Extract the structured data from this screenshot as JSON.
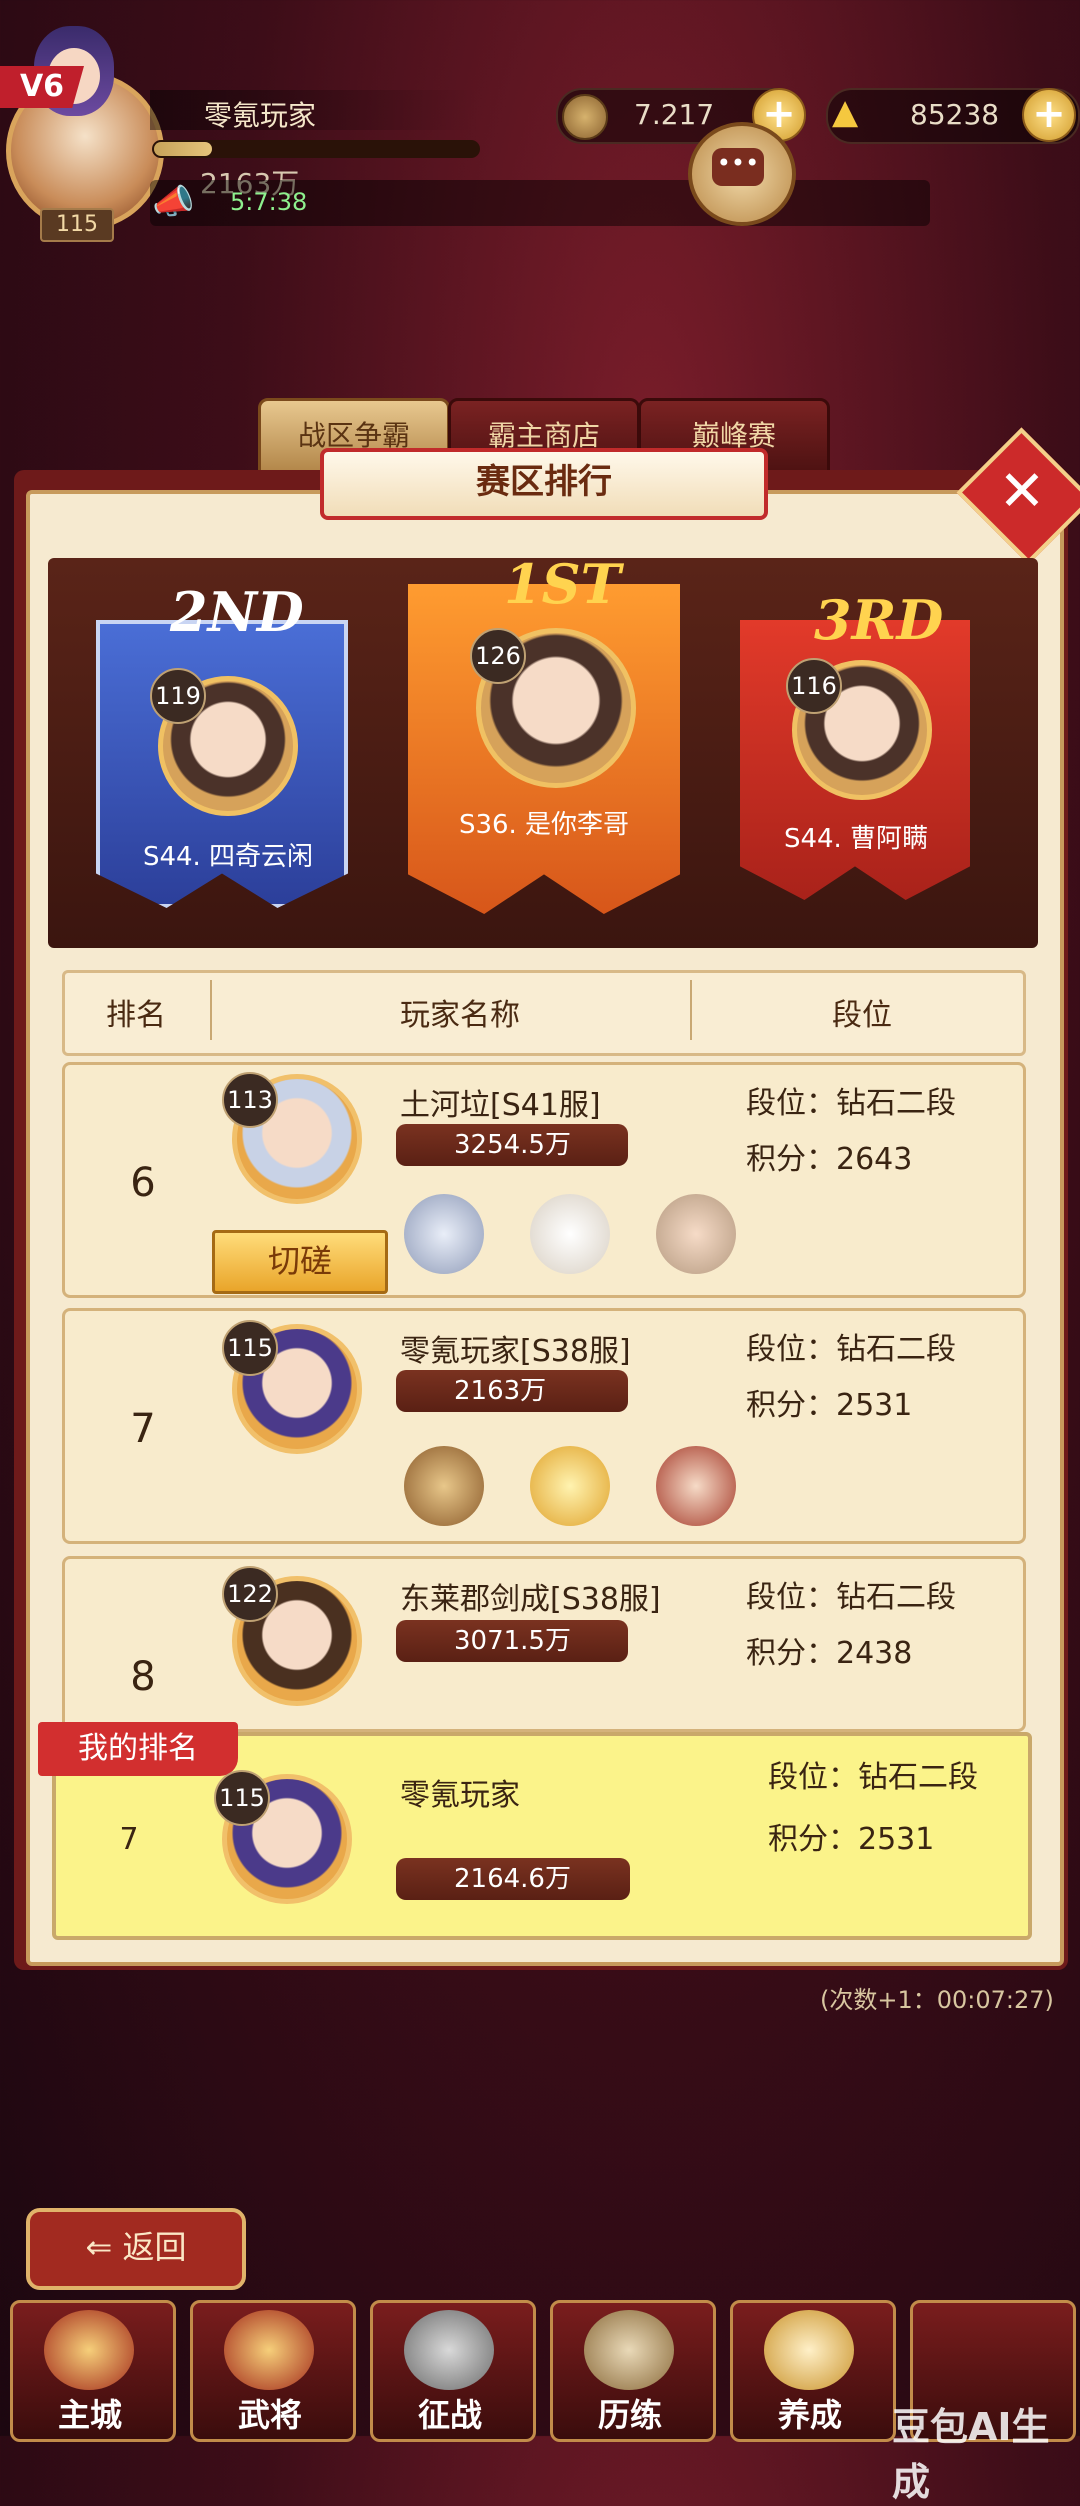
{
  "header": {
    "vip": "V6",
    "player_name": "零氪玩家",
    "level": "115",
    "power": "2163万",
    "exp_progress": 0.18,
    "chat_preview": "5:7:38",
    "copper": "7.217",
    "gold": "85238"
  },
  "tabs": [
    "战区争霸",
    "霸主商店",
    "巅峰赛"
  ],
  "panel_title": "赛区排行",
  "podium": {
    "second": {
      "place": "2ND",
      "level": "119",
      "name": "S44. 四奇云闲"
    },
    "first": {
      "place": "1ST",
      "level": "126",
      "name": "S36. 是你李哥"
    },
    "third": {
      "place": "3RD",
      "level": "116",
      "name": "S44. 曹阿瞒"
    }
  },
  "table_header": {
    "rank": "排名",
    "name": "玩家名称",
    "segment": "段位"
  },
  "rows": [
    {
      "rank": "6",
      "level": "113",
      "name": "土河垃[S41服]",
      "power": "3254.5万",
      "segment": "段位：钻石二段",
      "score": "积分：2643",
      "action": "切磋"
    },
    {
      "rank": "7",
      "level": "115",
      "name": "零氪玩家[S38服]",
      "power": "2163万",
      "segment": "段位：钻石二段",
      "score": "积分：2531"
    },
    {
      "rank": "8",
      "level": "122",
      "name": "东莱郡剑成[S38服]",
      "power": "3071.5万",
      "segment": "段位：钻石二段",
      "score": "积分：2438"
    }
  ],
  "my_rank": {
    "tag": "我的排名",
    "rank": "7",
    "level": "115",
    "name": "零氪玩家",
    "power": "2164.6万",
    "segment": "段位：钻石二段",
    "score": "积分：2531"
  },
  "timer": "(次数+1：00:07:27)",
  "back": "返回",
  "nav": [
    "主城",
    "武将",
    "征战",
    "历练",
    "养成"
  ],
  "watermark": "豆包AI生成",
  "icons": {
    "sword": "⚔",
    "back": "⇐",
    "plus": "+",
    "horn": "horn-icon",
    "chat": "chat-icon"
  }
}
